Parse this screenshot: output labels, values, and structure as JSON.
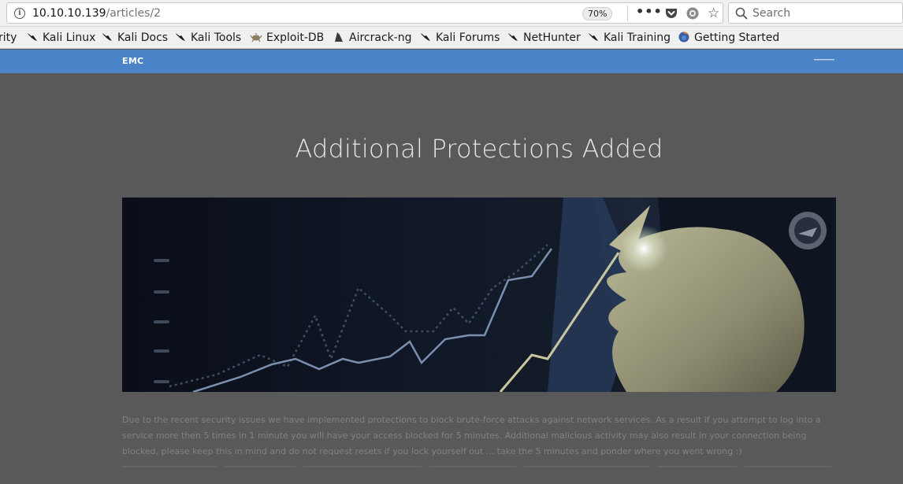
{
  "browser": {
    "url_host": "10.10.10.139",
    "url_path": "/articles/2",
    "zoom": "70%",
    "search_placeholder": "Search",
    "info_icon": "i",
    "more_icon": "•••",
    "star_icon": "☆"
  },
  "bookmarks": [
    {
      "label": "rity",
      "icon": "kali-dragon-icon"
    },
    {
      "label": "Kali Linux",
      "icon": "kali-dragon-icon"
    },
    {
      "label": "Kali Docs",
      "icon": "kali-dragon-icon"
    },
    {
      "label": "Kali Tools",
      "icon": "kali-dragon-icon"
    },
    {
      "label": "Exploit-DB",
      "icon": "exploit-db-icon"
    },
    {
      "label": "Aircrack-ng",
      "icon": "aircrack-icon"
    },
    {
      "label": "Kali Forums",
      "icon": "kali-dragon-icon"
    },
    {
      "label": "NetHunter",
      "icon": "kali-dragon-icon"
    },
    {
      "label": "Kali Training",
      "icon": "kali-dragon-icon"
    },
    {
      "label": "Getting Started",
      "icon": "firefox-icon"
    }
  ],
  "site": {
    "brand": "EMC",
    "nav_accent": "#4a83c6"
  },
  "article": {
    "title": "Additional Protections Added",
    "body": "Due to the recent security issues we have implemented protections to block brute-force attacks against network services. As a result if you attempt to log into a service more then 5 times in 1 minute you will have your access blocked for 5 minutes. Additional malicious activity may also result in your connection being blocked, please keep this in mind and do not request resets if you lock yourself out ... take the 5 minutes and ponder where you went wrong :)"
  }
}
